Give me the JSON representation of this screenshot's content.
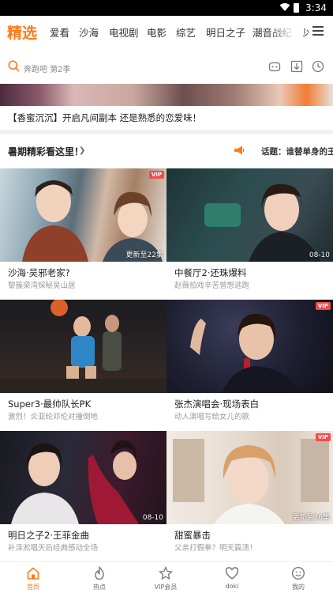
{
  "status_bar": {
    "time": "3:34"
  },
  "channels": {
    "active": "精选",
    "tabs": [
      "爱看",
      "沙海",
      "电视剧",
      "电影",
      "综艺",
      "明日之子",
      "潮音战纪",
      "少"
    ]
  },
  "search": {
    "placeholder": "奔跑吧 第2季"
  },
  "headline": "【香蜜沉沉】开启凡间副本 还是熟悉的恋爱味！",
  "section": {
    "title": "暑期精彩看这里！",
    "topic": "话题：谁替单身的王"
  },
  "cards": [
    {
      "title": "沙海·吴邪老家?",
      "subtitle": "黎簇梁湾探秘吴山居",
      "badge": "VIP",
      "overlay": "更新至22集"
    },
    {
      "title": "中餐厅2·还珠爆料",
      "subtitle": "赵薇拍戏辛苦曾想逃跑",
      "badge": "",
      "overlay": "08-10"
    },
    {
      "title": "Super3·最帅队长PK",
      "subtitle": "激烈！炎亚纶邓伦对撞倒地",
      "badge": "",
      "overlay": ""
    },
    {
      "title": "张杰演唱会·现场表白",
      "subtitle": "动人演唱写给女儿的歌",
      "badge": "VIP",
      "overlay": ""
    },
    {
      "title": "明日之子2·王菲金曲",
      "subtitle": "补泽淞唱天后经典感动全场",
      "badge": "",
      "overlay": "08-10"
    },
    {
      "title": "甜蜜暴击",
      "subtitle": "父亲打假拳？明天篇渍！",
      "badge": "VIP",
      "overlay": "更新至36集"
    }
  ],
  "bottom_nav": [
    {
      "label": "首页",
      "icon": "home-icon"
    },
    {
      "label": "热点",
      "icon": "flame-icon"
    },
    {
      "label": "VIP会员",
      "icon": "vip-star-icon"
    },
    {
      "label": "doki",
      "icon": "doki-heart-icon"
    },
    {
      "label": "我的",
      "icon": "profile-face-icon"
    }
  ],
  "colors": {
    "accent": "#ff7a16",
    "vip_badge": "#f14c4c"
  }
}
